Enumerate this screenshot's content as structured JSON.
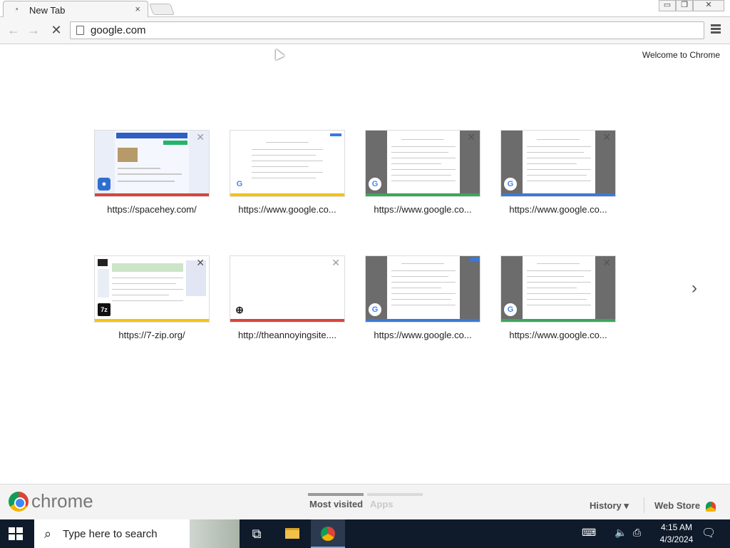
{
  "browser": {
    "tab": {
      "title": "New Tab",
      "close": "×"
    },
    "window_controls": {
      "minimize": "▭",
      "maximize": "❐",
      "close": "✕"
    },
    "toolbar": {
      "back": "←",
      "forward": "→",
      "stop": "✕"
    },
    "omnibox": {
      "value": "google.com"
    }
  },
  "page": {
    "welcome": "Welcome to Chrome",
    "tiles": [
      {
        "title": "https://spacehey.com/",
        "bar_color": "#d9453a"
      },
      {
        "title": "https://www.google.co...",
        "bar_color": "#f2c318"
      },
      {
        "title": "https://www.google.co...",
        "bar_color": "#3aa65a"
      },
      {
        "title": "https://www.google.co...",
        "bar_color": "#3b79d7"
      },
      {
        "title": "https://7-zip.org/",
        "bar_color": "#f2c318"
      },
      {
        "title": "http://theannoyingsite....",
        "bar_color": "#d9453a"
      },
      {
        "title": "https://www.google.co...",
        "bar_color": "#3b79d7"
      },
      {
        "title": "https://www.google.co...",
        "bar_color": "#3aa65a"
      }
    ],
    "next_arrow": "›"
  },
  "footer": {
    "brand": "chrome",
    "tabs": {
      "most_visited": "Most visited",
      "apps": "Apps"
    },
    "history": "History ▾",
    "web_store": "Web Store"
  },
  "taskbar": {
    "search_placeholder": "Type here to search",
    "time": "4:15 AM",
    "date": "4/3/2024"
  }
}
